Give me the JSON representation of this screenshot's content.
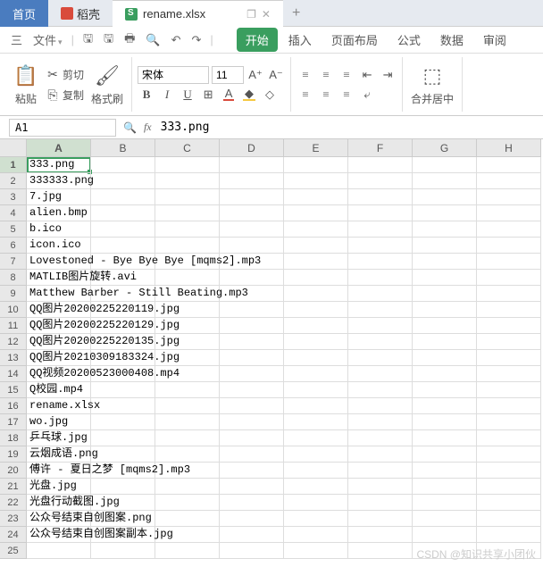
{
  "titlebar": {
    "home": "首页",
    "dkq": "稻壳",
    "filename": "rename.xlsx",
    "plus": "+"
  },
  "quickbar": {
    "menu": "三",
    "file_label": "文件"
  },
  "ribbon_tabs": {
    "start": "开始",
    "insert": "插入",
    "page": "页面布局",
    "formula": "公式",
    "data": "数据",
    "review": "审阅"
  },
  "ribbon": {
    "cut": "剪切",
    "copy": "复制",
    "paste": "粘贴",
    "format_painter": "格式刷",
    "font_name": "宋体",
    "font_size": "11",
    "merge": "合并居中"
  },
  "namebox": {
    "ref": "A1",
    "formula": "333.png"
  },
  "columns": [
    "A",
    "B",
    "C",
    "D",
    "E",
    "F",
    "G",
    "H"
  ],
  "rows": [
    {
      "n": 1,
      "v": "333.png"
    },
    {
      "n": 2,
      "v": "333333.png"
    },
    {
      "n": 3,
      "v": "7.jpg"
    },
    {
      "n": 4,
      "v": "alien.bmp"
    },
    {
      "n": 5,
      "v": "b.ico"
    },
    {
      "n": 6,
      "v": "icon.ico"
    },
    {
      "n": 7,
      "v": "Lovestoned - Bye Bye Bye [mqms2].mp3"
    },
    {
      "n": 8,
      "v": "MATLIB图片旋转.avi"
    },
    {
      "n": 9,
      "v": "Matthew Barber - Still Beating.mp3"
    },
    {
      "n": 10,
      "v": "QQ图片20200225220119.jpg"
    },
    {
      "n": 11,
      "v": "QQ图片20200225220129.jpg"
    },
    {
      "n": 12,
      "v": "QQ图片20200225220135.jpg"
    },
    {
      "n": 13,
      "v": "QQ图片20210309183324.jpg"
    },
    {
      "n": 14,
      "v": "QQ视频20200523000408.mp4"
    },
    {
      "n": 15,
      "v": "Q校园.mp4"
    },
    {
      "n": 16,
      "v": "rename.xlsx"
    },
    {
      "n": 17,
      "v": "wo.jpg"
    },
    {
      "n": 18,
      "v": "乒乓球.jpg"
    },
    {
      "n": 19,
      "v": "云烟成语.png"
    },
    {
      "n": 20,
      "v": "傅许 - 夏日之梦 [mqms2].mp3"
    },
    {
      "n": 21,
      "v": "光盘.jpg"
    },
    {
      "n": 22,
      "v": "光盘行动截图.jpg"
    },
    {
      "n": 23,
      "v": "公众号结束自创图案.png"
    },
    {
      "n": 24,
      "v": "公众号结束自创图案副本.jpg"
    },
    {
      "n": 25,
      "v": ""
    }
  ],
  "watermark": "CSDN @知识共享小团伙"
}
